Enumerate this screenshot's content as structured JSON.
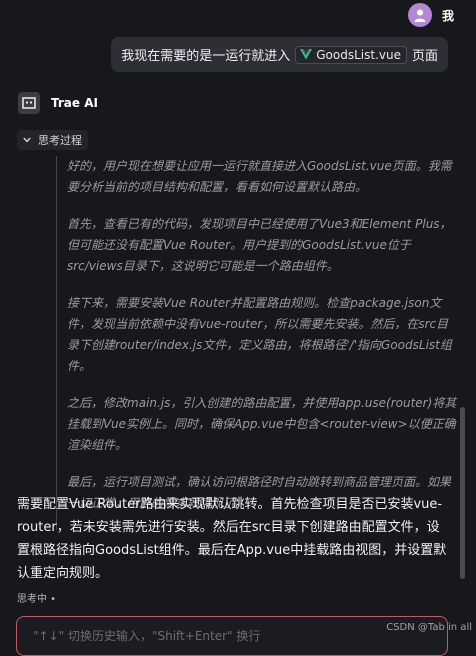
{
  "user": {
    "name": "我"
  },
  "user_message": {
    "text_before": "我现在需要的是一运行就进入",
    "file_name": "GoodsList.vue",
    "text_after": "页面"
  },
  "ai": {
    "name": "Trae AI"
  },
  "thinking": {
    "toggle_label": "思考过程",
    "paragraphs": [
      "好的，用户现在想要让应用一运行就直接进入GoodsList.vue页面。我需要分析当前的项目结构和配置，看看如何设置默认路由。",
      "首先，查看已有的代码，发现项目中已经使用了Vue3和Element Plus，但可能还没有配置Vue Router。用户提到的GoodsList.vue位于src/views目录下，这说明它可能是一个路由组件。",
      "接下来，需要安装Vue Router并配置路由规则。检查package.json文件，发现当前依赖中没有vue-router，所以需要先安装。然后，在src目录下创建router/index.js文件，定义路由，将根路径'/'指向GoodsList组件。",
      "之后，修改main.js，引入创建的路由配置，并使用app.use(router)将其挂载到Vue实例上。同时，确保App.vue中包含<router-view>以便正确渲染组件。",
      "最后，运行项目测试，确认访问根路径时自动跳转到商品管理页面。如果一切正常，用户的需求就实现了。"
    ]
  },
  "answer": "需要配置Vue Router路由来实现默认跳转。首先检查项目是否已安装vue-router，若未安装需先进行安装。然后在src目录下创建路由配置文件，设置根路径指向GoodsList组件。最后在App.vue中挂载路由视图，并设置默认重定向规则。",
  "status": "思考中 •",
  "input": {
    "placeholder": "\"↑↓\" 切换历史输入，\"Shift+Enter\" 换行"
  },
  "watermark": "CSDN @Tab in all",
  "colors": {
    "background": "#17181c",
    "bubble": "#2d2f36",
    "avatar": "#b388d6",
    "vue_green": "#42b883",
    "input_border": "#c0586a"
  },
  "icons": {
    "avatar": "user-avatar-icon",
    "file": "vue-file-icon",
    "ai_logo": "trae-logo-icon",
    "toggle": "chevron-down-icon"
  }
}
